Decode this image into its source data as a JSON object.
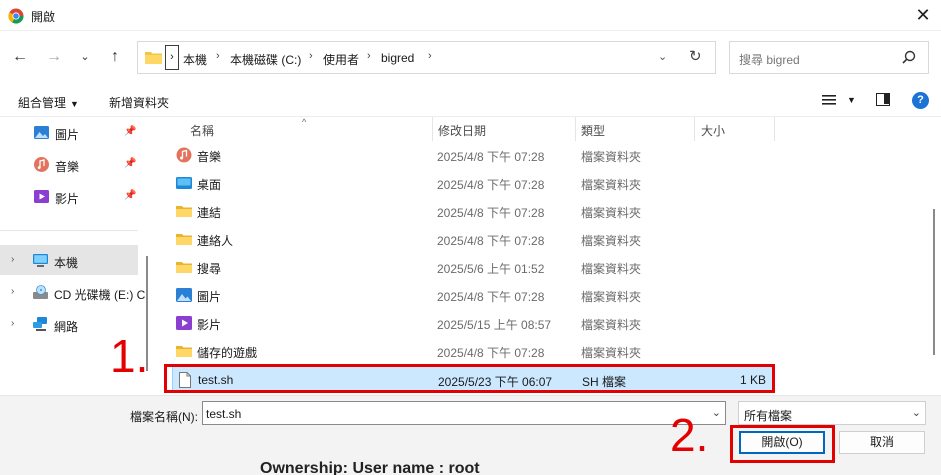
{
  "window": {
    "title": "開啟",
    "close_glyph": "✕"
  },
  "navigation": {
    "breadcrumb": [
      "本機",
      "本機磁碟 (C:)",
      "使用者",
      "bigred"
    ],
    "search_placeholder": "搜尋 bigred"
  },
  "toolbar": {
    "organize_label": "組合管理",
    "new_folder_label": "新增資料夾"
  },
  "sidebar": {
    "quick_access": [
      {
        "label": "圖片",
        "icon": "pictures-icon"
      },
      {
        "label": "音樂",
        "icon": "music-icon"
      },
      {
        "label": "影片",
        "icon": "videos-icon"
      }
    ],
    "tree": [
      {
        "label": "本機",
        "icon": "computer-icon",
        "selected": true
      },
      {
        "label": "CD 光碟機 (E:) C",
        "icon": "cd-drive-icon",
        "selected": false
      },
      {
        "label": "網路",
        "icon": "network-icon",
        "selected": false
      }
    ]
  },
  "file_list": {
    "columns": {
      "name": "名稱",
      "date": "修改日期",
      "type": "類型",
      "size": "大小"
    },
    "rows": [
      {
        "name": "音樂",
        "date": "2025/4/8 下午 07:28",
        "type": "檔案資料夾",
        "size": "",
        "icon": "music-folder-icon"
      },
      {
        "name": "桌面",
        "date": "2025/4/8 下午 07:28",
        "type": "檔案資料夾",
        "size": "",
        "icon": "desktop-folder-icon"
      },
      {
        "name": "連結",
        "date": "2025/4/8 下午 07:28",
        "type": "檔案資料夾",
        "size": "",
        "icon": "folder-icon"
      },
      {
        "name": "連絡人",
        "date": "2025/4/8 下午 07:28",
        "type": "檔案資料夾",
        "size": "",
        "icon": "folder-icon"
      },
      {
        "name": "搜尋",
        "date": "2025/5/6 上午 01:52",
        "type": "檔案資料夾",
        "size": "",
        "icon": "folder-icon"
      },
      {
        "name": "圖片",
        "date": "2025/4/8 下午 07:28",
        "type": "檔案資料夾",
        "size": "",
        "icon": "pictures-folder-icon"
      },
      {
        "name": "影片",
        "date": "2025/5/15 上午 08:57",
        "type": "檔案資料夾",
        "size": "",
        "icon": "videos-folder-icon"
      },
      {
        "name": "儲存的遊戲",
        "date": "2025/4/8 下午 07:28",
        "type": "檔案資料夾",
        "size": "",
        "icon": "folder-icon"
      },
      {
        "name": "test.sh",
        "date": "2025/5/23 下午 06:07",
        "type": "SH 檔案",
        "size": "1 KB",
        "icon": "file-icon",
        "selected": true
      }
    ]
  },
  "footer": {
    "filename_label": "檔案名稱(N):",
    "filename_value": "test.sh",
    "filter_value": "所有檔案",
    "open_label": "開啟(O)",
    "cancel_label": "取消",
    "behind_text": "Ownership:          User name :          root"
  },
  "annotations": {
    "step1": "1.",
    "step2": "2.",
    "color": "#e30000"
  },
  "colors": {
    "selection": "#cce8ff",
    "accent": "#0067c0",
    "folder": "#f4c542"
  }
}
